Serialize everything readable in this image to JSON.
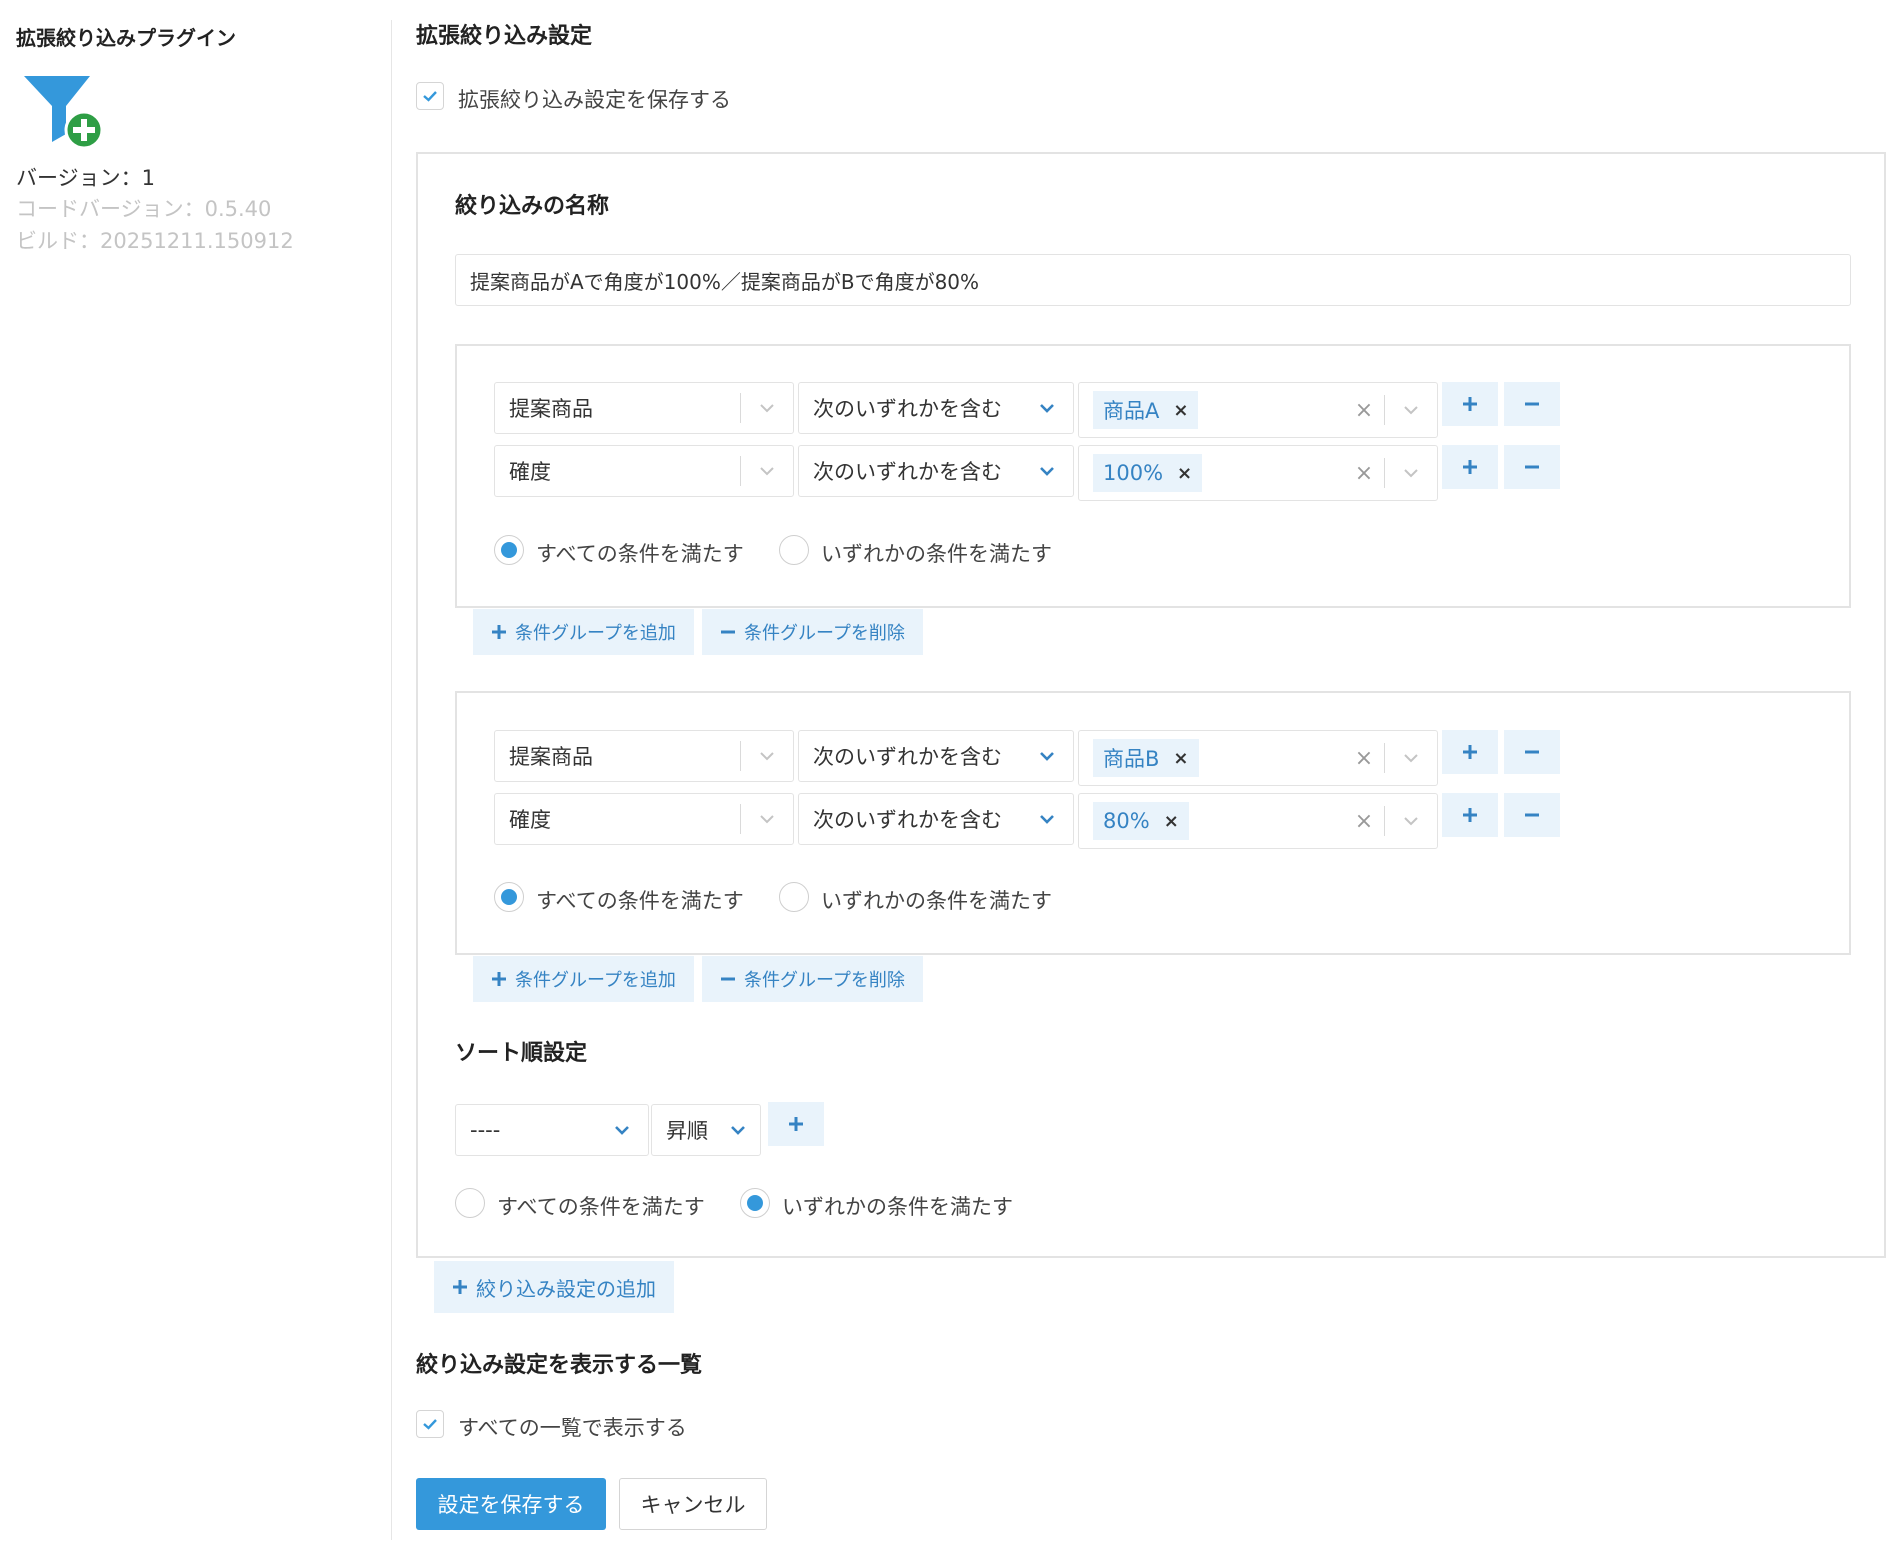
{
  "sidebar": {
    "plugin_title": "拡張絞り込みプラグイン",
    "logo_icon": "filter-plus-icon",
    "version": "バージョン：1",
    "code_version": "コードバージョン：0.5.40",
    "build": "ビルド：20251211.150912"
  },
  "settings": {
    "heading": "拡張絞り込み設定",
    "save_checkbox_label": "拡張絞り込み設定を保存する",
    "save_checked": true
  },
  "filter": {
    "name_heading": "絞り込みの名称",
    "name_value": "提案商品がAで角度が100%／提案商品がBで角度が80%",
    "groups": [
      {
        "conditions": [
          {
            "field": "提案商品",
            "operator": "次のいずれかを含む",
            "tag": "商品A",
            "tag_remove": "×"
          },
          {
            "field": "確度",
            "operator": "次のいずれかを含む",
            "tag": "100%",
            "tag_remove": "×"
          }
        ],
        "match_all_label": "すべての条件を満たす",
        "match_any_label": "いずれかの条件を満たす",
        "selected": "all"
      },
      {
        "conditions": [
          {
            "field": "提案商品",
            "operator": "次のいずれかを含む",
            "tag": "商品B",
            "tag_remove": "×"
          },
          {
            "field": "確度",
            "operator": "次のいずれかを含む",
            "tag": "80%",
            "tag_remove": "×"
          }
        ],
        "match_all_label": "すべての条件を満たす",
        "match_any_label": "いずれかの条件を満たす",
        "selected": "all"
      }
    ],
    "add_group_label": "条件グループを追加",
    "delete_group_label": "条件グループを削除",
    "clear_symbol": "×"
  },
  "sort": {
    "heading": "ソート順設定",
    "field_value": "----",
    "order_value": "昇順",
    "match_all_label": "すべての条件を満たす",
    "match_any_label": "いずれかの条件を満たす",
    "selected": "any"
  },
  "add_filter_label": "絞り込み設定の追加",
  "display": {
    "heading": "絞り込み設定を表示する一覧",
    "all_lists_label": "すべての一覧で表示する",
    "all_lists_checked": true
  },
  "actions": {
    "save_label": "設定を保存する",
    "cancel_label": "キャンセル"
  },
  "colors": {
    "accent": "#3498db",
    "accent_light": "#e9f3fb",
    "accent_text": "#3583c3",
    "logo_funnel": "#3498db",
    "logo_plus": "#2e9e45"
  }
}
